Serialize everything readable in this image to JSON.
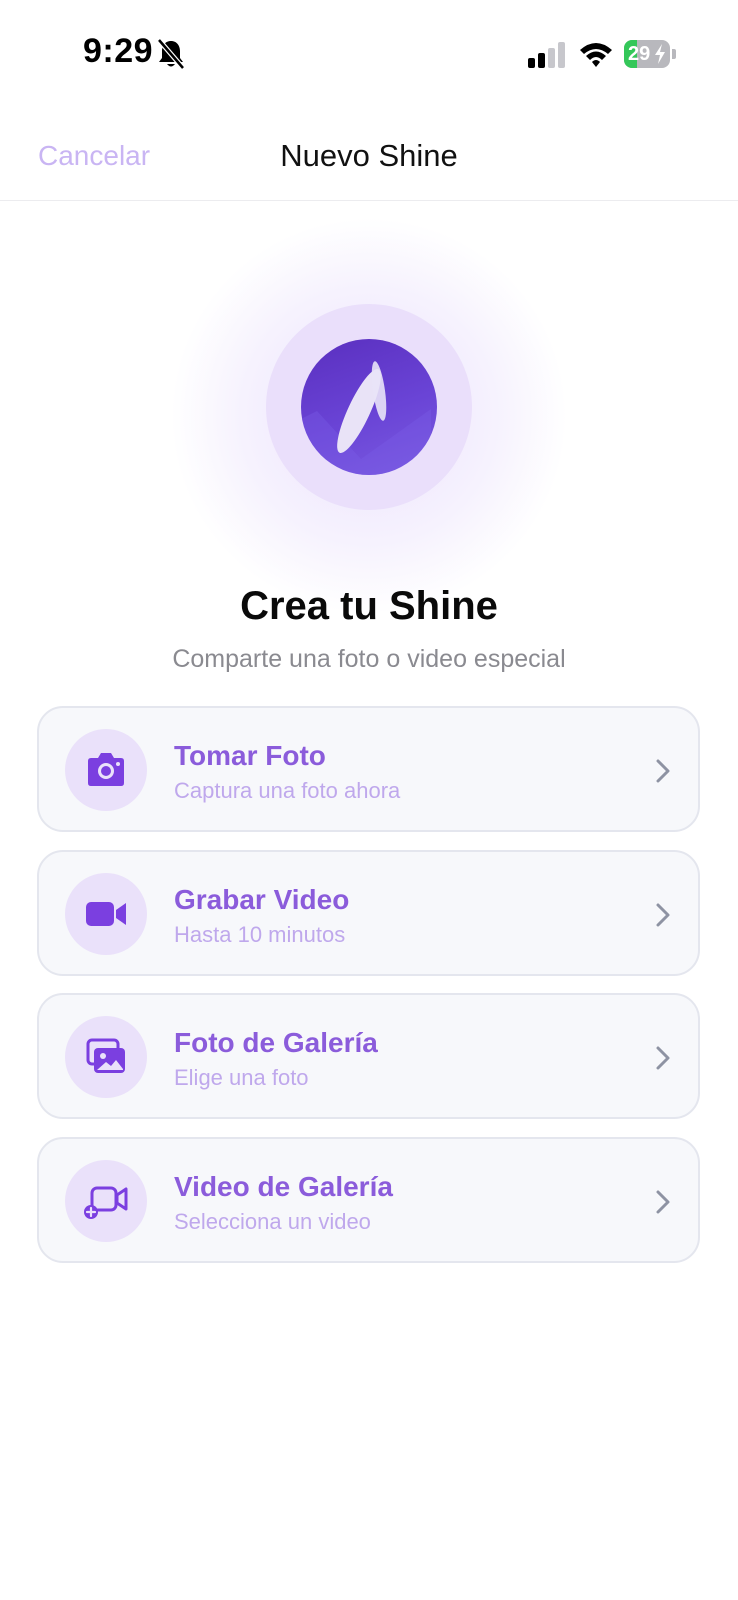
{
  "status_bar": {
    "time": "9:29",
    "battery_level": "29",
    "battery_fraction": 0.29,
    "icons": [
      "bell-slash-icon",
      "cellular-signal-icon",
      "wifi-icon",
      "battery-charging-icon"
    ]
  },
  "nav": {
    "cancel_label": "Cancelar",
    "title": "Nuevo Shine"
  },
  "hero": {
    "title": "Crea tu Shine",
    "subtitle": "Comparte una foto o video especial"
  },
  "options": [
    {
      "title": "Tomar Foto",
      "subtitle": "Captura una foto ahora",
      "icon": "camera-icon"
    },
    {
      "title": "Grabar Video",
      "subtitle": "Hasta 10 minutos",
      "icon": "video-camera-icon"
    },
    {
      "title": "Foto de Galería",
      "subtitle": "Elige una foto",
      "icon": "photo-gallery-icon"
    },
    {
      "title": "Video de Galería",
      "subtitle": "Selecciona un video",
      "icon": "video-gallery-icon"
    }
  ],
  "colors": {
    "accent": "#8B5CDB",
    "accent_light": "#EAE1FA",
    "cancel": "#C9B5F3",
    "icon_fill": "#7B3FE0"
  }
}
